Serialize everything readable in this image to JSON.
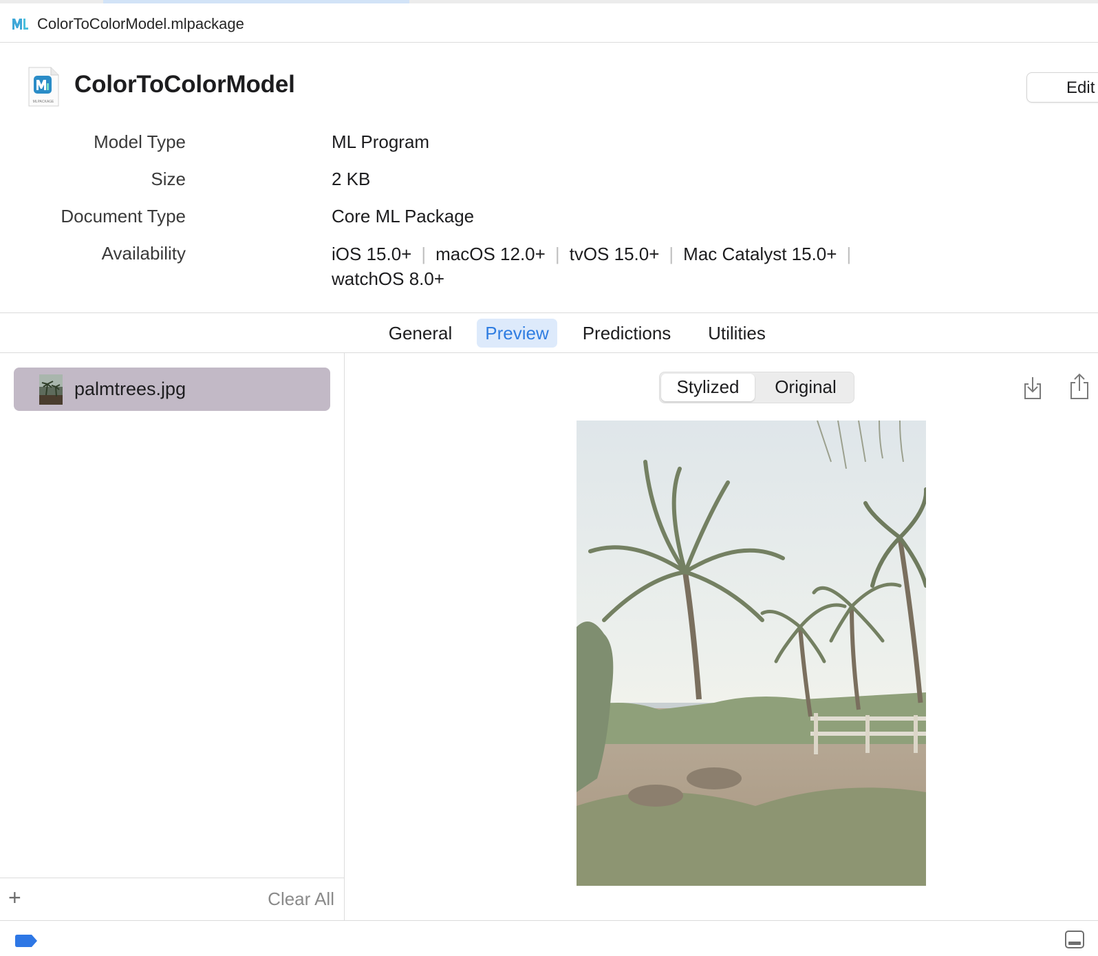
{
  "window": {
    "path_title": "ColorToColorModel.mlpackage",
    "path_icon": "coreml-file-icon"
  },
  "header": {
    "title": "ColorToColorModel",
    "icon": "mlpackage-document-icon",
    "icon_caption": "MLPACKAGE",
    "edit_label": "Edit"
  },
  "metadata": {
    "model_type_label": "Model Type",
    "model_type_value": "ML Program",
    "size_label": "Size",
    "size_value": "2 KB",
    "document_type_label": "Document Type",
    "document_type_value": "Core ML Package",
    "availability_label": "Availability",
    "availability": [
      "iOS 15.0+",
      "macOS 12.0+",
      "tvOS 15.0+",
      "Mac Catalyst 15.0+",
      "watchOS 8.0+"
    ]
  },
  "tabs": [
    {
      "label": "General",
      "active": false
    },
    {
      "label": "Preview",
      "active": true
    },
    {
      "label": "Predictions",
      "active": false
    },
    {
      "label": "Utilities",
      "active": false
    }
  ],
  "files": {
    "items": [
      {
        "name": "palmtrees.jpg",
        "selected": true
      }
    ],
    "add_icon": "plus-icon",
    "clear_all_label": "Clear All"
  },
  "preview": {
    "segments": [
      {
        "label": "Stylized",
        "selected": true
      },
      {
        "label": "Original",
        "selected": false
      }
    ],
    "save_icon": "download-icon",
    "share_icon": "share-icon",
    "image_alt": "palm trees preview"
  },
  "colors": {
    "accent": "#2f7de1",
    "tab_active_bg": "#ddeafb",
    "selected_row_bg": "#c2b9c6",
    "badge": "#2e77e5"
  },
  "bottom": {
    "badge_icon": "tag-badge-icon",
    "panel_icon": "toggle-panel-icon"
  }
}
